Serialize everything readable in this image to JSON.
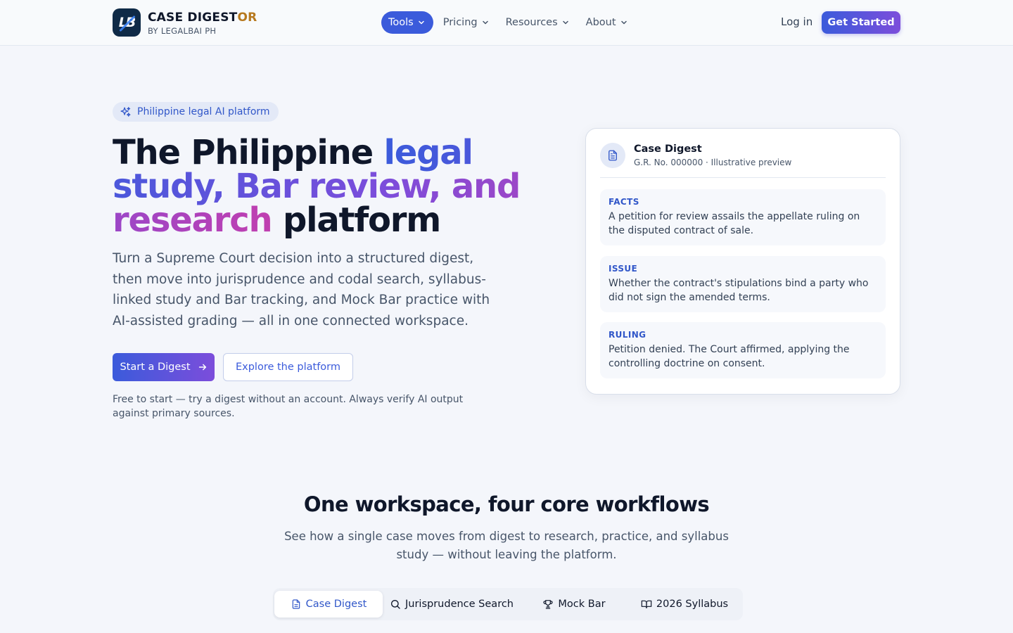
{
  "header": {
    "brand_name_main": "CASE DIGEST",
    "brand_name_accent": "OR",
    "brand_sub": "BY LEGALBAI PH",
    "logo_text": "LB",
    "nav": [
      {
        "label": "Tools",
        "active": true
      },
      {
        "label": "Pricing"
      },
      {
        "label": "Resources"
      },
      {
        "label": "About"
      }
    ],
    "login": "Log in",
    "cta": "Get Started"
  },
  "hero": {
    "badge": "Philippine legal AI platform",
    "title_part1": "The Philippine ",
    "title_highlight": "legal study, Bar review, and research",
    "title_part2": " platform",
    "description": "Turn a Supreme Court decision into a structured digest, then move into jurisprudence and codal search, syllabus-linked study and Bar tracking, and Mock Bar practice with AI-assisted grading — all in one connected workspace.",
    "primary_button": "Start a Digest",
    "secondary_button": "Explore the platform",
    "note": "Free to start — try a digest without an account. Always verify AI output against primary sources."
  },
  "preview": {
    "title": "Case Digest",
    "subtitle": "G.R. No. 000000 · Illustrative preview",
    "sections": [
      {
        "label": "FACTS",
        "text": "A petition for review assails the appellate ruling on the disputed contract of sale."
      },
      {
        "label": "ISSUE",
        "text": "Whether the contract's stipulations bind a party who did not sign the amended terms."
      },
      {
        "label": "RULING",
        "text": "Petition denied. The Court affirmed, applying the controlling doctrine on consent."
      }
    ]
  },
  "workflows": {
    "title": "One workspace, four core workflows",
    "subtitle": "See how a single case moves from digest to research, practice, and syllabus study — without leaving the platform.",
    "tabs": [
      {
        "label": "Case Digest",
        "icon": "document-icon",
        "active": true
      },
      {
        "label": "Jurisprudence Search",
        "icon": "search-icon"
      },
      {
        "label": "Mock Bar",
        "icon": "trophy-icon"
      },
      {
        "label": "2026 Syllabus",
        "icon": "book-icon"
      }
    ]
  },
  "colors": {
    "primary": "#3b5bdb",
    "gradient_end": "#7c4ddb",
    "accent_gold": "#b7791f",
    "background": "#f4f6fb"
  }
}
